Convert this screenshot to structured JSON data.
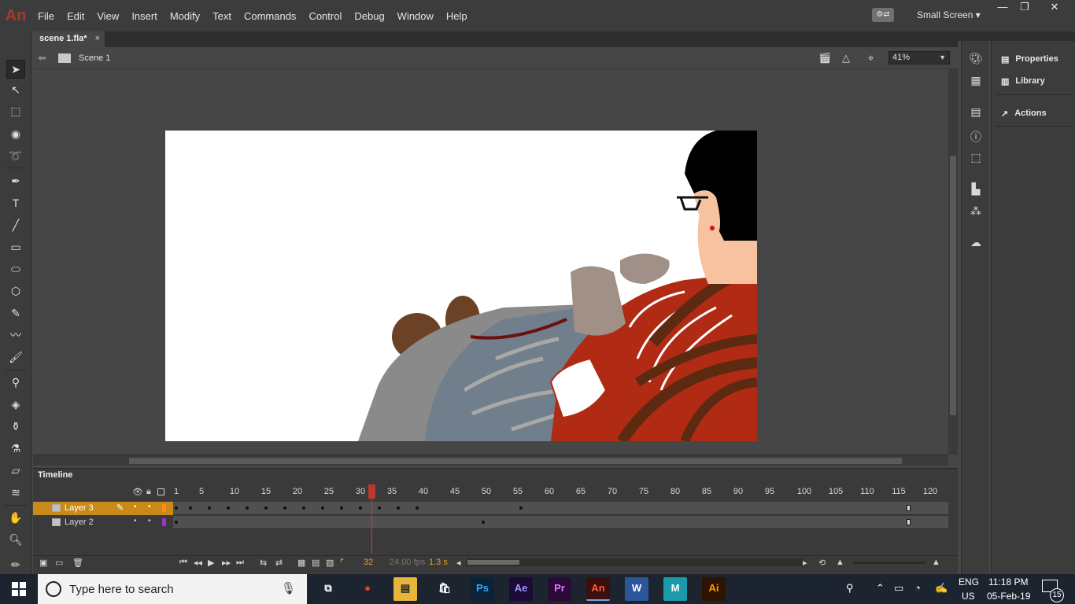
{
  "app": {
    "logo": "An",
    "accent": "#d23b2f"
  },
  "menu": [
    "File",
    "Edit",
    "View",
    "Insert",
    "Modify",
    "Text",
    "Commands",
    "Control",
    "Debug",
    "Window",
    "Help"
  ],
  "workspace": {
    "label": "Small Screen ▾"
  },
  "window_controls": {
    "minimize": "—",
    "restore": "❐",
    "close": "✕"
  },
  "document": {
    "tab_label": "scene 1.fla*",
    "close_glyph": "×"
  },
  "editbar": {
    "scene_label": "Scene 1",
    "zoom": "41%"
  },
  "toolbar": {
    "tools": [
      "selection-tool",
      "subselection-tool",
      "free-transform-tool",
      "3d-rotation-tool",
      "lasso-tool",
      "pen-tool",
      "text-tool",
      "line-tool",
      "rectangle-tool",
      "oval-tool",
      "polystar-tool",
      "pencil-tool",
      "paint-brush-tool",
      "brush-tool",
      "bone-tool",
      "paint-bucket-tool",
      "ink-bottle-tool",
      "eyedropper-tool",
      "eraser-tool",
      "width-tool",
      "hand-tool",
      "zoom-tool",
      "stroke-color-tool"
    ]
  },
  "timeline": {
    "title": "Timeline",
    "ruler": [
      "1",
      "5",
      "10",
      "15",
      "20",
      "25",
      "30",
      "35",
      "40",
      "45",
      "50",
      "55",
      "60",
      "65",
      "70",
      "75",
      "80",
      "85",
      "90",
      "95",
      "100",
      "105",
      "110",
      "115",
      "120"
    ],
    "layers": [
      {
        "name": "Layer 3",
        "color": "#ff8c1a",
        "selected": true
      },
      {
        "name": "Layer 2",
        "color": "#9933cc",
        "selected": false
      }
    ],
    "current_frame": "32",
    "fps": "24.00 fps",
    "time": "1.3 s"
  },
  "panels": [
    {
      "label": "Properties",
      "icon": "properties-icon"
    },
    {
      "label": "Library",
      "icon": "library-icon"
    },
    {
      "label": "Actions",
      "icon": "actions-icon"
    }
  ],
  "taskbar": {
    "search_placeholder": "Type here to search",
    "apps": [
      {
        "name": "task-view",
        "label": "⧉",
        "color": "#1c2430"
      },
      {
        "name": "chrome",
        "label": "●",
        "color": "#1c2430"
      },
      {
        "name": "file-explorer",
        "label": "▤",
        "color": "#e8b53a"
      },
      {
        "name": "store",
        "label": "🛍",
        "color": "#1c2430"
      },
      {
        "name": "photoshop",
        "label": "Ps",
        "color": "#0b2338"
      },
      {
        "name": "after-effects",
        "label": "Ae",
        "color": "#1b0b36"
      },
      {
        "name": "premiere",
        "label": "Pr",
        "color": "#2a0a36"
      },
      {
        "name": "animate",
        "label": "An",
        "color": "#3a0f0c"
      },
      {
        "name": "word",
        "label": "W",
        "color": "#2b579a"
      },
      {
        "name": "maya",
        "label": "M",
        "color": "#1b9aaa"
      },
      {
        "name": "illustrator",
        "label": "Ai",
        "color": "#2e1400"
      }
    ],
    "language_1": "ENG",
    "language_2": "US",
    "time": "11:18 PM",
    "date": "05-Feb-19",
    "notifications": "15"
  }
}
